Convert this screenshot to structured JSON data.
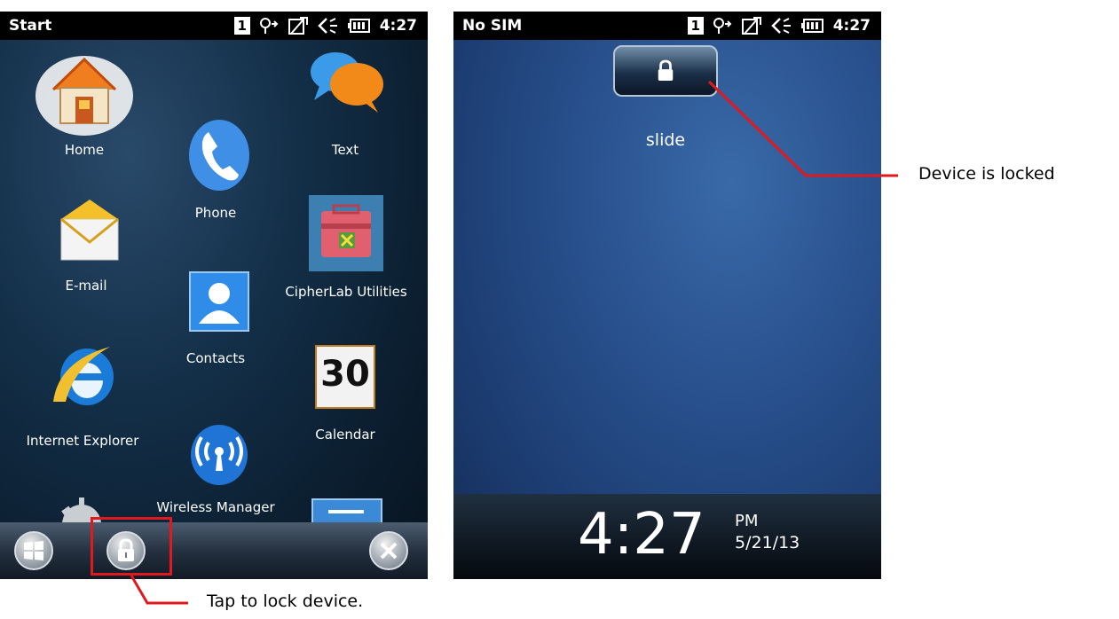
{
  "left_screen": {
    "status": {
      "title": "Start",
      "sim_badge": "1",
      "time": "4:27"
    },
    "apps": {
      "home": "Home",
      "text": "Text",
      "phone": "Phone",
      "email": "E-mail",
      "cipherlab": "CipherLab Utilities",
      "contacts": "Contacts",
      "ie": "Internet Explorer",
      "calendar": "Calendar",
      "calendar_day": "30",
      "wireless": "Wireless Manager"
    }
  },
  "right_screen": {
    "status": {
      "title": "No SIM",
      "sim_badge": "1",
      "time": "4:27"
    },
    "slide_label": "slide",
    "clock": {
      "time": "4:27",
      "ampm": "PM",
      "date": "5/21/13"
    }
  },
  "annotations": {
    "lock_hint": "Tap to lock device.",
    "locked_note": "Device is locked"
  },
  "colors": {
    "callout": "#e0191f"
  }
}
